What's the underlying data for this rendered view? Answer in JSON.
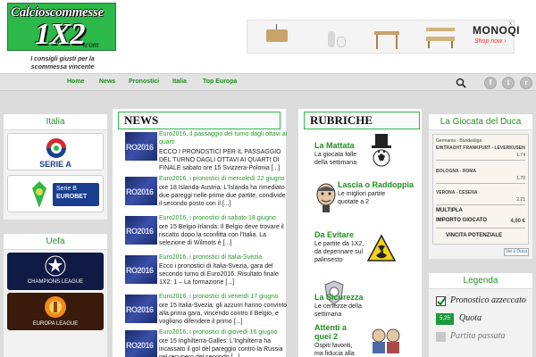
{
  "header": {
    "logo_line1": "Calcioscommesse",
    "logo_line2": "1X2",
    "logo_line3": ".com",
    "tagline": "I consigli giusti per la scommessa vincente"
  },
  "ad": {
    "brand": "MONOQI",
    "cta": "Shop now ›",
    "close": "x"
  },
  "nav": {
    "items": [
      "Home",
      "News",
      "Pronostici",
      "Italia",
      "Top Europa"
    ]
  },
  "social": {
    "facebook": "f",
    "twitter": "t",
    "rss": "r"
  },
  "sidebar_left": {
    "italia_title": "Italia",
    "seriea_label": "SERIE A",
    "serieb_label": "Serie B",
    "serieb_sub": "EUROBET",
    "uefa_title": "Uefa",
    "champions_label": "CHAMPIONS LEAGUE",
    "europa_label": "EUROPA LEAGUE"
  },
  "news": {
    "header": "NEWS",
    "thumb_text": "RO2016",
    "items": [
      {
        "title": "Euro2016, il passaggio del turno dagli ottavi ai quarti",
        "excerpt": "ECCO I PRONOSTICI PER IL PASSAGGIO DEL TURNO DAGLI OTTAVI AI QUARTI DI FINALE sabato ore 15 Svizzera-Polonia [...]"
      },
      {
        "title": "Euro2016, i pronostici di mercoledì 22 giugno",
        "excerpt": "ore 18 Islanda-Austria: L'Islanda ha rimediato due pareggi nelle prime due partite, condivide il secondo posto con il [...]"
      },
      {
        "title": "Euro2016, i pronostici di sabato 18 giugno",
        "excerpt": "ore 15 Belgio-Irlanda: Il Belgio deve trovare il riscatto dopo la sconfitta con l'Italia. La selezione di Wilmots è [...]"
      },
      {
        "title": "Euro2016, i pronostici di Italia-Svezia",
        "excerpt": "Ecco i pronostici di Italia-Svezia, gara del secondo turno di Euro2016. Risultato finale 1X2: 1 – La formazione [...]"
      },
      {
        "title": "Euro2016, i pronostici di venerdì 17 giugno",
        "excerpt": "ore 15 Italia-Svezia: gli azzurri hanno convinto alla prima gara, vincendo contro il Belgio, e vogliono difendere il primo [...]"
      },
      {
        "title": "Euro2016, i pronostici di giovedì 16 giugno",
        "excerpt": "ore 15 Inghilterra-Galles: L'Inghilterra ha incassato il gol del pareggio contro la Russia nel recupero del secondo [...]"
      }
    ]
  },
  "rubriche": {
    "header": "RUBRICHE",
    "items": [
      {
        "title": "La Mattata",
        "desc": "La giocata folle della settimana"
      },
      {
        "title": "Lascia o Raddoppia",
        "desc": "Le migliori partite quotate a 2"
      },
      {
        "title": "Da Evitare",
        "desc": "Le partite da 1X2, da depennare sul palinsesto"
      },
      {
        "title": "La Sicurezza",
        "desc": "Le certezze della settimana"
      },
      {
        "title": "Attenti a quei 2",
        "desc": "Ospiti favoriti, ma fiducia alla"
      }
    ]
  },
  "duca": {
    "title": "La Giocata del Duca",
    "slip_header": "Germania - Bundesliga",
    "match1": "EINTRACHT FRANKFURT - LEVERKUSEN",
    "odd1": "1.74",
    "match2": "BOLOGNA - ROMA",
    "odd2": "1.70",
    "match3": "VERONA - CESENA",
    "odd3": "2.21",
    "multipla": "MULTIPLA",
    "importo_label": "IMPORTO GIOCATO",
    "importo_value": "4,00 €",
    "vincita_label": "VINCITA POTENZIALE",
    "button": "Vai a Duca"
  },
  "legenda": {
    "title": "Legenda",
    "items": [
      {
        "label": "Pronostico azzeccato"
      },
      {
        "badge": "5,25",
        "label": "Quota"
      },
      {
        "label": "Partita passata"
      }
    ]
  }
}
